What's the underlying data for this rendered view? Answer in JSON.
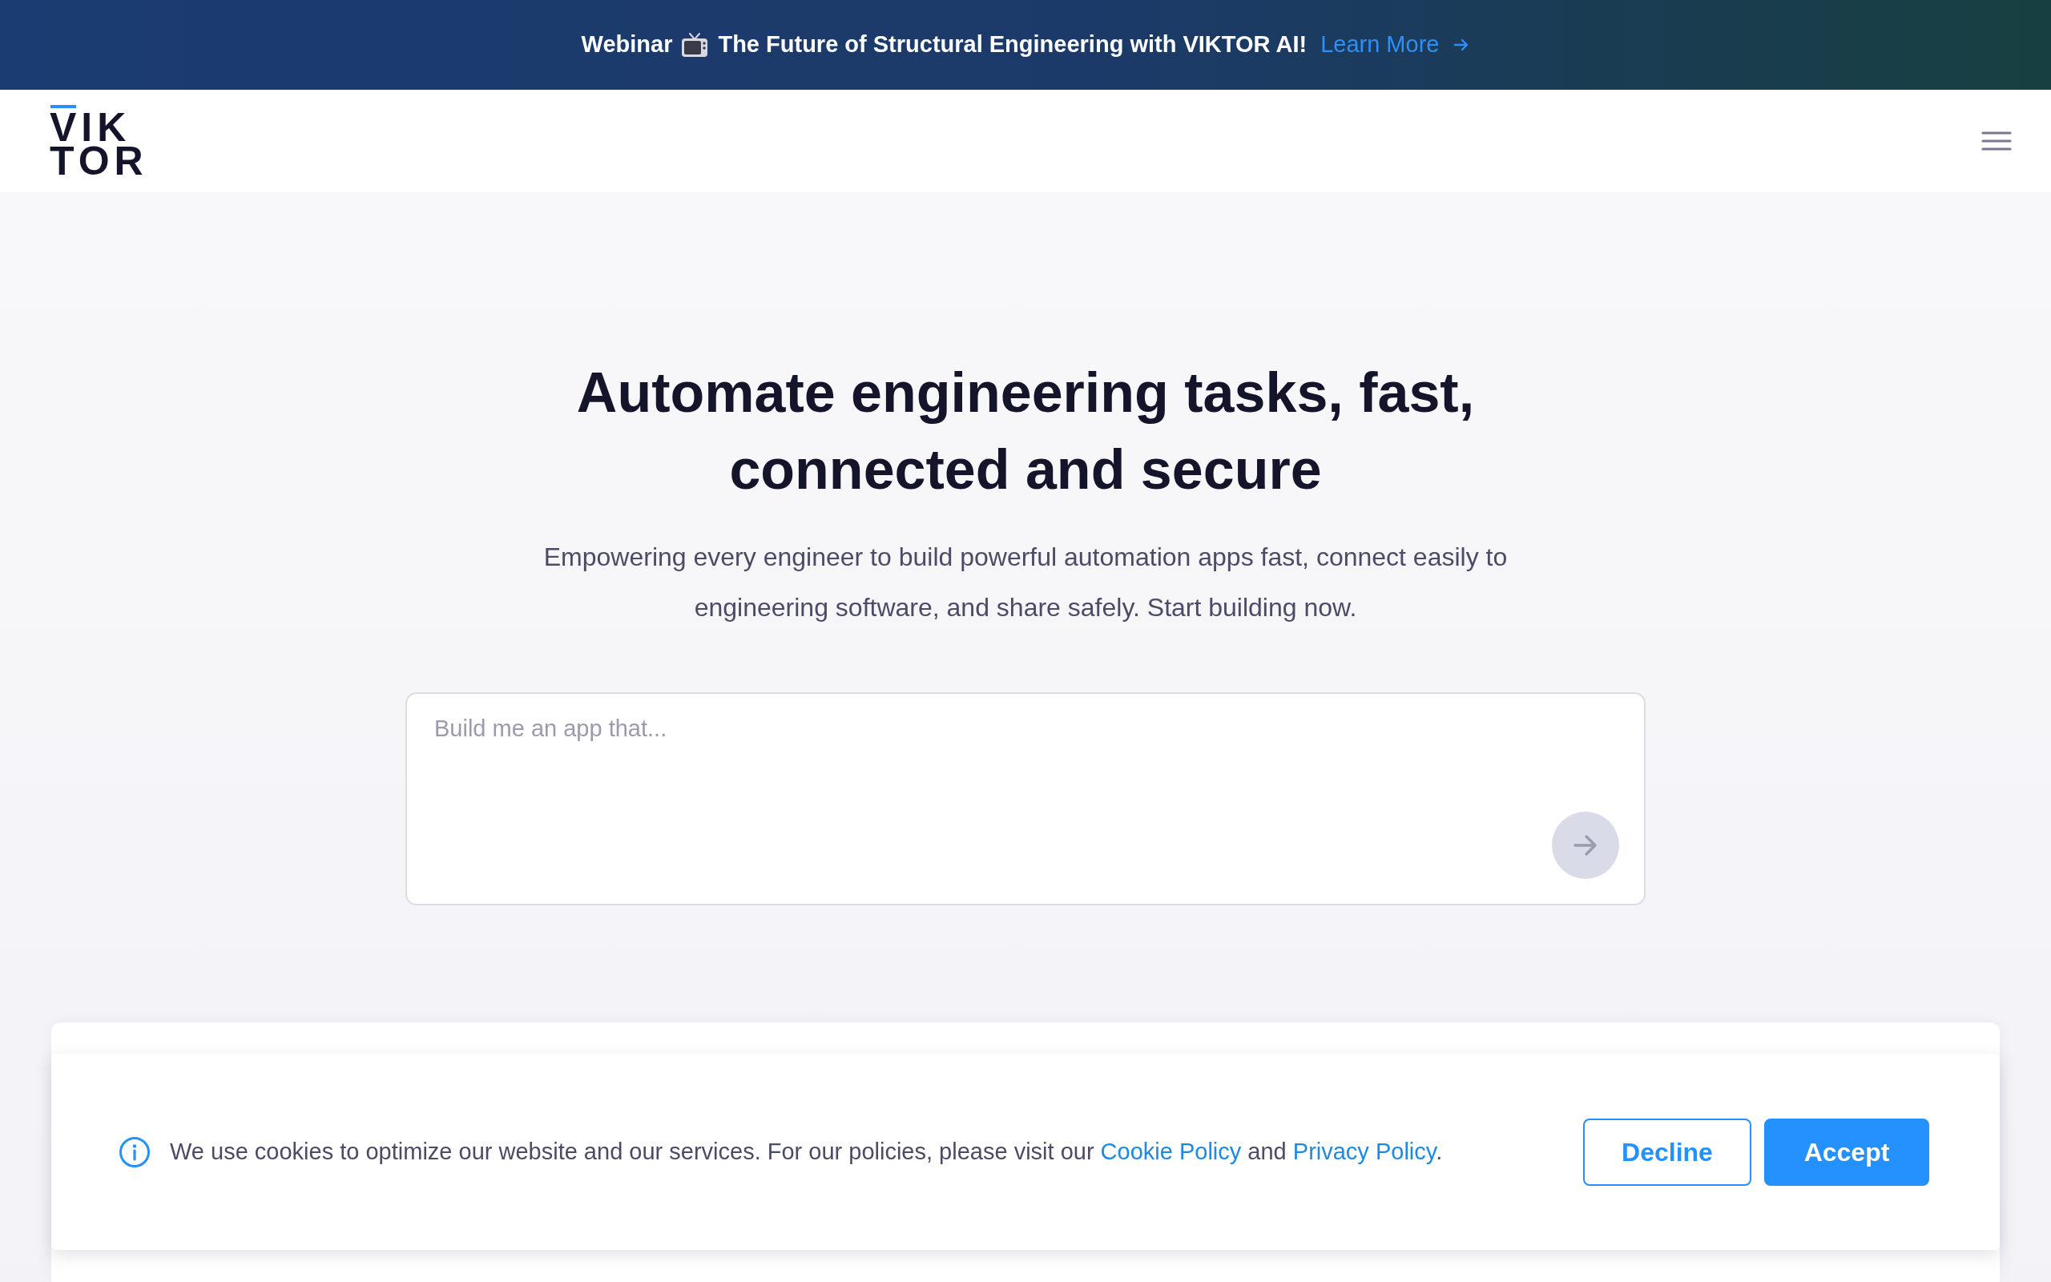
{
  "announcement": {
    "tag": "Webinar",
    "title": "The Future of Structural Engineering with VIKTOR AI!",
    "link": "Learn More"
  },
  "header": {
    "logo": {
      "line_1": "VIK",
      "line_2": "TOR"
    }
  },
  "hero": {
    "heading": "Automate engineering tasks, fast, connected and secure",
    "subheading": "Empowering every engineer to build powerful automation apps fast, connect easily to engineering software, and share safely. Start building now.",
    "prompt": {
      "placeholder": "Build me an app that..."
    }
  },
  "cookie_notice": {
    "segments": [
      {
        "kind": "text",
        "text": "We use cookies to optimize our website and our services. For our policies, please visit our "
      },
      {
        "kind": "link",
        "text": "Cookie Policy"
      },
      {
        "kind": "text",
        "text": " and "
      },
      {
        "kind": "link",
        "text": "Privacy Policy"
      },
      {
        "kind": "text",
        "text": "."
      }
    ],
    "buttons": [
      {
        "label": "Decline",
        "kind": "outline"
      },
      {
        "label": "Accept",
        "kind": "primary"
      }
    ]
  }
}
